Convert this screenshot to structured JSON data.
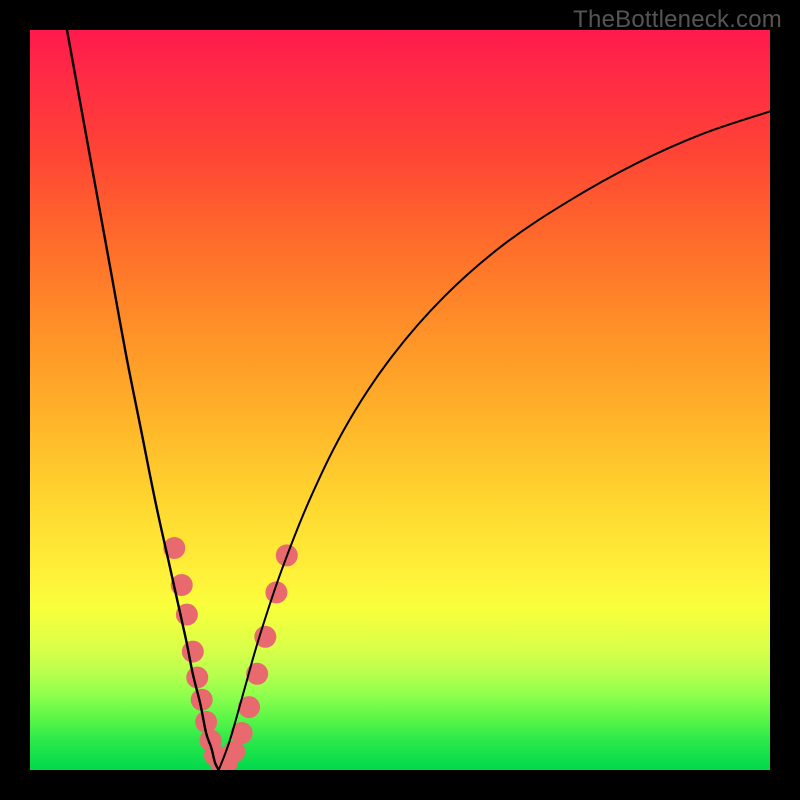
{
  "watermark": "TheBottleneck.com",
  "colors": {
    "background": "#000000",
    "dot": "#e86a6f",
    "curve": "#000000"
  },
  "chart_data": {
    "type": "line",
    "title": "",
    "xlabel": "",
    "ylabel": "",
    "xlim": [
      0,
      100
    ],
    "ylim": [
      0,
      100
    ],
    "grid": false,
    "legend": false,
    "note": "V-shaped bottleneck curve; vertical axis = bottleneck % (100 at top, 0 at bottom); horizontal axis = component balance. Values estimated from pixel positions; no numeric axis labels are shown in the image.",
    "series": [
      {
        "name": "left-branch",
        "x": [
          5,
          7,
          9,
          11,
          13,
          15,
          17,
          19,
          21,
          22,
          23,
          23.8,
          24.5,
          25,
          25.5
        ],
        "y": [
          100,
          89,
          78,
          67,
          56,
          46,
          36,
          27,
          18,
          13,
          9,
          5,
          3,
          1,
          0
        ]
      },
      {
        "name": "right-branch",
        "x": [
          25.5,
          27,
          29,
          31,
          34,
          38,
          43,
          49,
          56,
          64,
          73,
          82,
          91,
          100
        ],
        "y": [
          0,
          4,
          11,
          18,
          27,
          37,
          47,
          56,
          64,
          71,
          77,
          82,
          86,
          89
        ]
      }
    ],
    "highlight_points": {
      "name": "sample-dots",
      "points": [
        {
          "x": 19.5,
          "y": 30
        },
        {
          "x": 20.5,
          "y": 25
        },
        {
          "x": 21.2,
          "y": 21
        },
        {
          "x": 22.0,
          "y": 16
        },
        {
          "x": 22.6,
          "y": 12.5
        },
        {
          "x": 23.2,
          "y": 9.5
        },
        {
          "x": 23.8,
          "y": 6.5
        },
        {
          "x": 24.4,
          "y": 4
        },
        {
          "x": 25.0,
          "y": 2
        },
        {
          "x": 25.8,
          "y": 1
        },
        {
          "x": 26.6,
          "y": 1
        },
        {
          "x": 27.6,
          "y": 2.5
        },
        {
          "x": 28.6,
          "y": 5
        },
        {
          "x": 29.6,
          "y": 8.5
        },
        {
          "x": 30.7,
          "y": 13
        },
        {
          "x": 31.8,
          "y": 18
        },
        {
          "x": 33.3,
          "y": 24
        },
        {
          "x": 34.7,
          "y": 29
        }
      ]
    }
  }
}
